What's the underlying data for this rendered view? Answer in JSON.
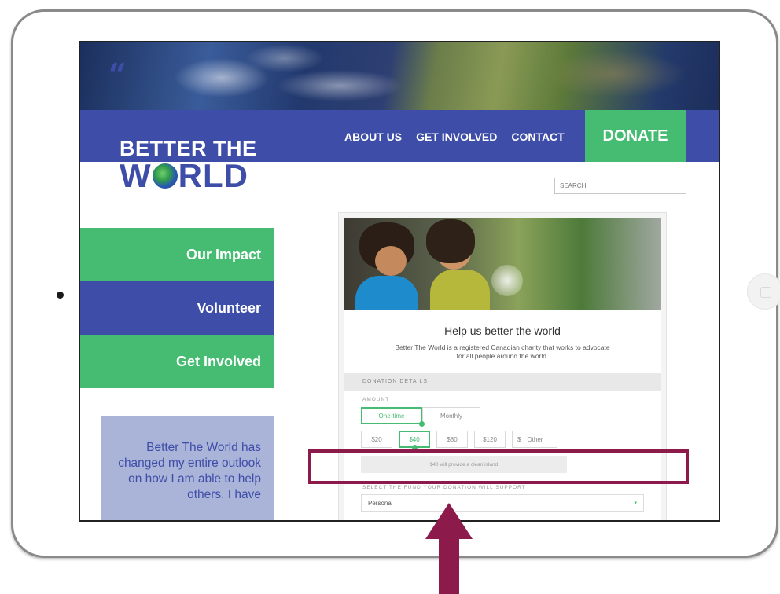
{
  "header": {
    "logo_top": "BETTER THE",
    "logo_bottom_left": "W",
    "logo_bottom_right": "RLD",
    "nav": [
      "ABOUT US",
      "GET INVOLVED",
      "CONTACT"
    ],
    "donate": "DONATE",
    "search_placeholder": "SEARCH"
  },
  "sidebar": {
    "items": [
      "Our Impact",
      "Volunteer",
      "Get Involved"
    ],
    "quote": "Better The World has changed my entire outlook on how I am able to help others. I have"
  },
  "donation": {
    "title": "Help us better the world",
    "description": "Better The World is a registered Canadian charity that works to advocate for all people around the world.",
    "section_label": "DONATION DETAILS",
    "amount_label": "AMOUNT",
    "frequency": [
      "One-time",
      "Monthly"
    ],
    "amounts": [
      "$20",
      "$40",
      "$80",
      "$120"
    ],
    "other_currency": "$",
    "other_label": "Other",
    "impact_text": "$40 will provide a clean island",
    "fund_label": "SELECT THE FUND YOUR DONATION WILL SUPPORT",
    "fund_value": "Personal",
    "fund_arrow": "▾"
  },
  "colors": {
    "brand_blue": "#3e4ea8",
    "brand_green": "#45bc72",
    "annotation": "#8c1a4b"
  },
  "icons": {
    "globe": "globe-icon",
    "quote": "quote-icon",
    "dropdown": "chevron-down-icon"
  }
}
